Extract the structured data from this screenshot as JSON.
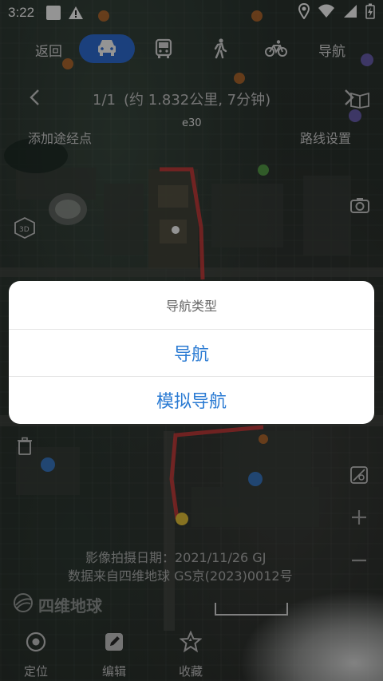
{
  "status_bar": {
    "time": "3:22"
  },
  "top_bar": {
    "back_label": "返回",
    "modes": [
      "car-icon",
      "bus-icon",
      "walk-icon",
      "bike-icon"
    ],
    "active_mode": "car-icon",
    "nav_label": "导航",
    "accent_color": "#2f6fd8"
  },
  "route": {
    "page": "1/1",
    "summary": "(约 1.832公里, 7分钟)",
    "add_waypoint": "添加途经点",
    "settings": "路线设置"
  },
  "dialog": {
    "title": "导航类型",
    "options": [
      "导航",
      "模拟导航"
    ],
    "option_color": "#2b7bd3"
  },
  "map": {
    "capture_date": "影像拍摄日期：2021/11/26 GJ",
    "data_source": "数据来自四维地球 GS京(2023)0012号",
    "brand": "四维地球",
    "road_label": "e30"
  },
  "bottom_bar": {
    "tabs": [
      {
        "label": "定位",
        "icon": "locate-icon"
      },
      {
        "label": "编辑",
        "icon": "edit-icon"
      },
      {
        "label": "收藏",
        "icon": "favorite-icon"
      }
    ]
  }
}
